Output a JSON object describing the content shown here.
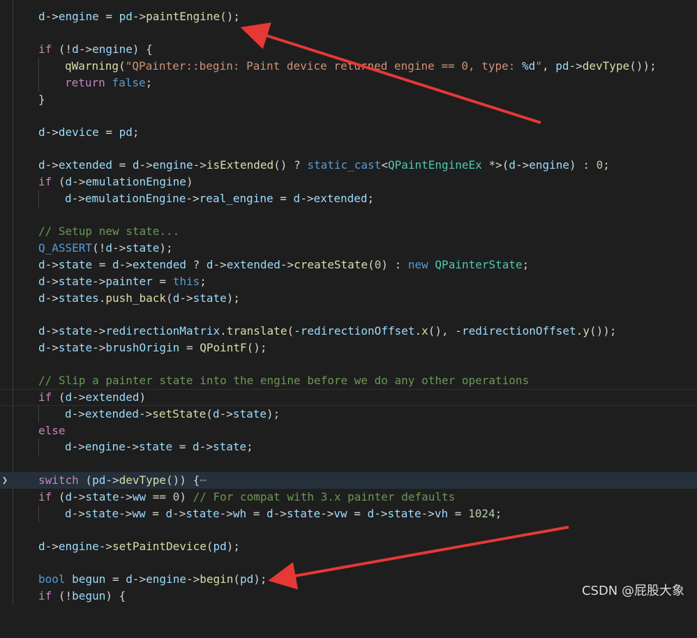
{
  "colors": {
    "background": "#1e1e1e",
    "keyword": "#569cd6",
    "control": "#c586c0",
    "function": "#dcdcaa",
    "variable": "#9cdcfe",
    "string": "#ce9178",
    "number": "#b5cea8",
    "comment": "#6a9955",
    "type": "#4ec9b0",
    "arrow": "#e53935"
  },
  "code": {
    "l1": [
      "d->engine = pd->",
      "paintEngine",
      "();"
    ],
    "l2": [
      "if",
      " (!",
      "d",
      "->",
      "engine",
      ") {"
    ],
    "l3": [
      "qWarning",
      "(",
      "\"QPainter::begin: Paint device returned engine == 0, type: ",
      "%d",
      "\"",
      ", ",
      "pd",
      "->",
      "devType",
      "());"
    ],
    "l4": [
      "return",
      " ",
      "false",
      ";"
    ],
    "l5": "}",
    "l6": [
      "d",
      "->",
      "device",
      " = ",
      "pd",
      ";"
    ],
    "l7": [
      "d",
      "->",
      "extended",
      " = ",
      "d",
      "->",
      "engine",
      "->",
      "isExtended",
      "() ? ",
      "static_cast",
      "<",
      "QPaintEngineEx",
      " *>(",
      "d",
      "->",
      "engine",
      ") : ",
      "0",
      ";"
    ],
    "l8": [
      "if",
      " (",
      "d",
      "->",
      "emulationEngine",
      ")"
    ],
    "l9": [
      "d",
      "->",
      "emulationEngine",
      "->",
      "real_engine",
      " = ",
      "d",
      "->",
      "extended",
      ";"
    ],
    "l10": "// Setup new state...",
    "l11": [
      "Q_ASSERT",
      "(!",
      "d",
      "->",
      "state",
      ");"
    ],
    "l12": [
      "d",
      "->",
      "state",
      " = ",
      "d",
      "->",
      "extended",
      " ? ",
      "d",
      "->",
      "extended",
      "->",
      "createState",
      "(",
      "0",
      ") : ",
      "new",
      " ",
      "QPainterState",
      ";"
    ],
    "l13": [
      "d",
      "->",
      "state",
      "->",
      "painter",
      " = ",
      "this",
      ";"
    ],
    "l14": [
      "d",
      "->",
      "states",
      ".",
      "push_back",
      "(",
      "d",
      "->",
      "state",
      ");"
    ],
    "l15": [
      "d",
      "->",
      "state",
      "->",
      "redirectionMatrix",
      ".",
      "translate",
      "(-",
      "redirectionOffset",
      ".",
      "x",
      "(), -",
      "redirectionOffset",
      ".",
      "y",
      "());"
    ],
    "l16": [
      "d",
      "->",
      "state",
      "->",
      "brushOrigin",
      " = ",
      "QPointF",
      "();"
    ],
    "l17": "// Slip a painter state into the engine before we do any other operations",
    "l18": [
      "if",
      " (",
      "d",
      "->",
      "extended",
      ")"
    ],
    "l19": [
      "d",
      "->",
      "extended",
      "->",
      "setState",
      "(",
      "d",
      "->",
      "state",
      ");"
    ],
    "l20": "else",
    "l21": [
      "d",
      "->",
      "engine",
      "->",
      "state",
      " = ",
      "d",
      "->",
      "state",
      ";"
    ],
    "l22": [
      "switch",
      " (",
      "pd",
      "->",
      "devType",
      "()) {",
      "⋯"
    ],
    "l23": [
      "if",
      " (",
      "d",
      "->",
      "state",
      "->",
      "ww",
      " == ",
      "0",
      ") ",
      "// For compat with 3.x painter defaults"
    ],
    "l24": [
      "d",
      "->",
      "state",
      "->",
      "ww",
      " = ",
      "d",
      "->",
      "state",
      "->",
      "wh",
      " = ",
      "d",
      "->",
      "state",
      "->",
      "vw",
      " = ",
      "d",
      "->",
      "state",
      "->",
      "vh",
      " = ",
      "1024",
      ";"
    ],
    "l25": [
      "d",
      "->",
      "engine",
      "->",
      "setPaintDevice",
      "(",
      "pd",
      ");"
    ],
    "l26": [
      "bool",
      " ",
      "begun",
      " = ",
      "d",
      "->",
      "engine",
      "->",
      "begin",
      "(",
      "pd",
      ");"
    ],
    "l27": [
      "if",
      " (!",
      "begun",
      ") {"
    ]
  },
  "fold_icon": "chevron-right-icon",
  "watermark": "CSDN @屁股大象"
}
